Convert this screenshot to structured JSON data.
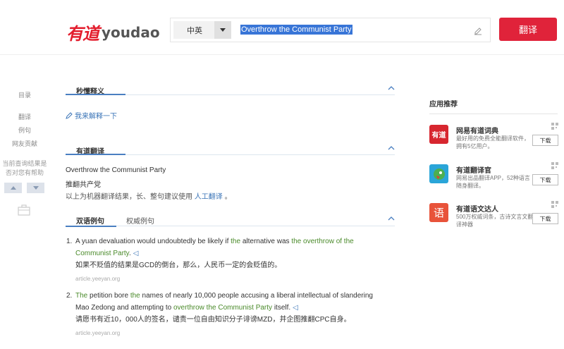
{
  "header": {
    "logo_cn": "有道",
    "logo_en": "youdao",
    "lang_select": "中英",
    "search_value": "Overthrow the Communist Party",
    "translate_label": "翻译"
  },
  "leftnav": {
    "catalog": "目录",
    "items": [
      "翻译",
      "例句",
      "网友贡献"
    ],
    "feedback_line1": "当前查询结果是",
    "feedback_line2": "否对您有帮助"
  },
  "sections": {
    "quick": {
      "title": "秒懂释义",
      "explain_link": "我来解释一下"
    },
    "youdao": {
      "title": "有道翻译",
      "source": "Overthrow the Communist Party",
      "target": "推翻共产党",
      "note_prefix": "以上为机器翻译结果，长、整句建议使用",
      "note_link": "人工翻译",
      "note_suffix": "。"
    },
    "tabs": {
      "active": "双语例句",
      "second": "权威例句"
    }
  },
  "examples": [
    {
      "num": "1.",
      "parts": [
        {
          "t": "A yuan devaluation would undoubtedly be likely if ",
          "hl": false
        },
        {
          "t": "the",
          "hl": true
        },
        {
          "t": " alternative was ",
          "hl": false
        },
        {
          "t": "the overthrow of the Communist Party",
          "hl": true
        },
        {
          "t": ".",
          "hl": false
        }
      ],
      "translation": "如果不贬值的结果是GCD的倒台，那么，人民币一定的会贬值的。",
      "source": "article.yeeyan.org"
    },
    {
      "num": "2.",
      "parts": [
        {
          "t": "The",
          "hl": true
        },
        {
          "t": " petition bore ",
          "hl": false
        },
        {
          "t": "the",
          "hl": true
        },
        {
          "t": " names of nearly 10,000 people accusing a liberal intellectual of slandering Mao Zedong and attempting to ",
          "hl": false
        },
        {
          "t": "overthrow the Communist Party",
          "hl": true
        },
        {
          "t": " itself.",
          "hl": false
        }
      ],
      "translation": "请愿书有近10，000人的签名，谴责一位自由知识分子诽谤MZD，并企图推翻CPC自身。",
      "source": "article.yeeyan.org"
    }
  ],
  "apps": {
    "title": "应用推荐",
    "items": [
      {
        "icon_text": "有道",
        "name": "网易有道词典",
        "desc": "最好用的免费全能翻译软件，拥有5亿用户。",
        "download": "下载",
        "color": "#d7262f"
      },
      {
        "icon_text": "",
        "name": "有道翻译官",
        "desc": "网易出品翻译APP，52种语言随身翻译。",
        "download": "下载",
        "color": "#2aa5d8"
      },
      {
        "icon_text": "语",
        "name": "有道语文达人",
        "desc": "500万权威词条，古诗文言文翻译神器",
        "download": "下载",
        "color": "#e8533a"
      }
    ]
  }
}
